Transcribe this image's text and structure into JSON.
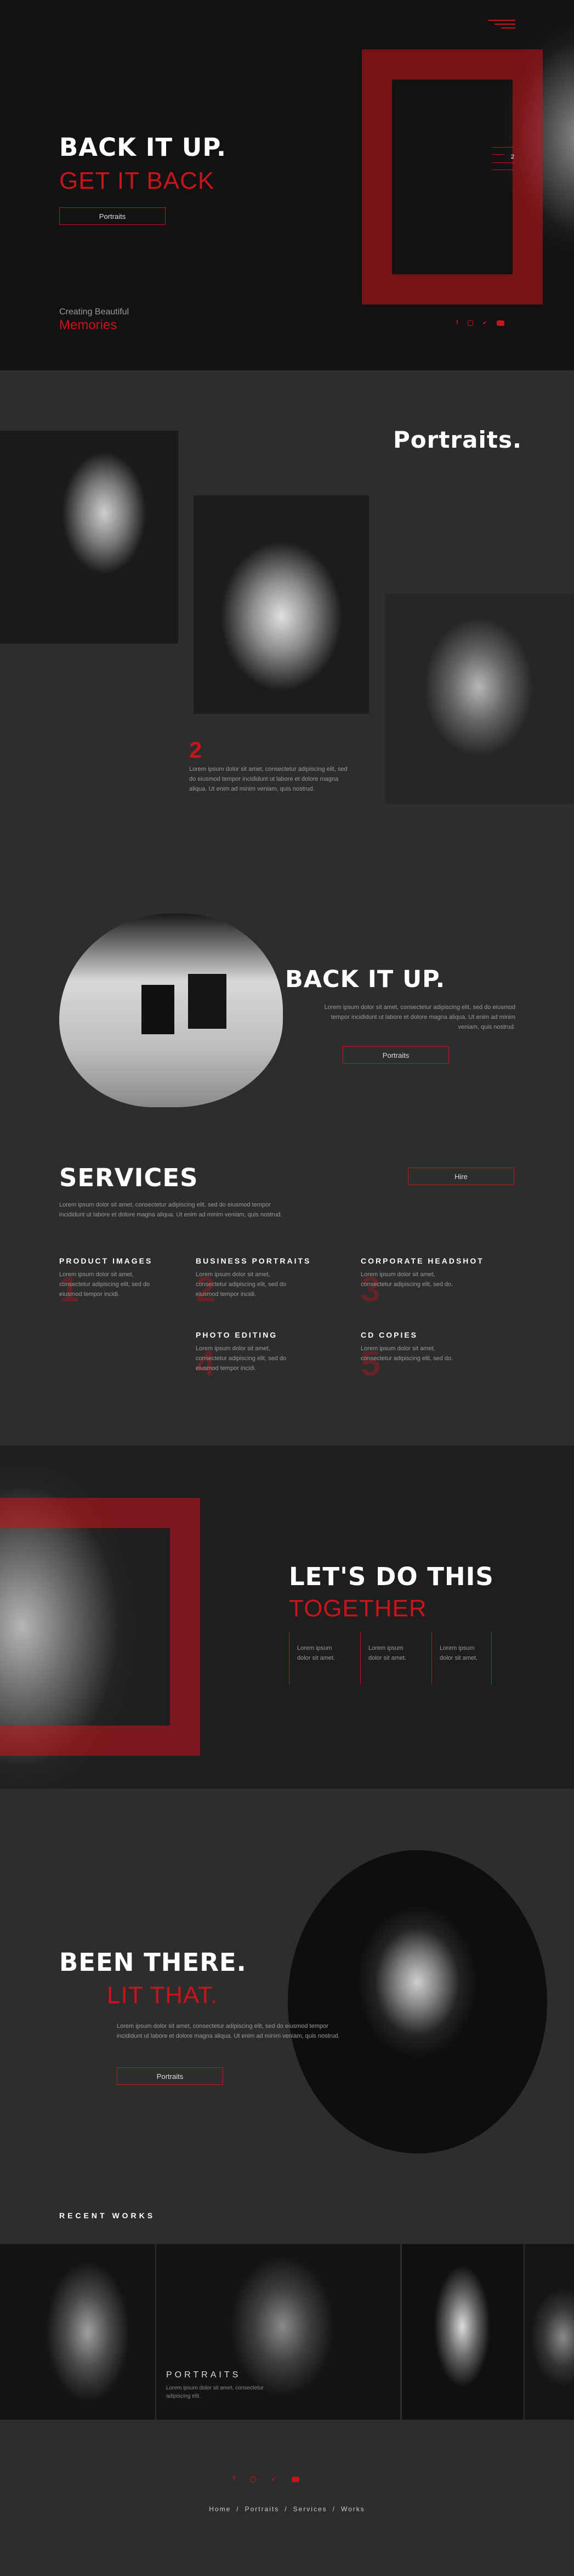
{
  "hero": {
    "title": "BACK IT UP.",
    "subtitle": "GET IT BACK",
    "button": "Portraits",
    "tagline": "Creating Beautiful",
    "tagline2": "Memories",
    "slide_number": "2"
  },
  "portraits": {
    "heading": "Portraits.",
    "number": "2",
    "text": "Lorem ipsum dolor sit amet, consectetur adipiscing elit, sed do eiusmod tempor incididunt ut labore et dolore magna aliqua. Ut enim ad minim veniam, quis nostrud."
  },
  "studio": {
    "title": "BACK IT UP.",
    "text": "Lorem ipsum dolor sit amet, consectetur adipiscing elit, sed do eiusmod tempor incididunt ut labore et dolore magna aliqua. Ut enim ad minim veniam, quis nostrud.",
    "button": "Portraits"
  },
  "services": {
    "title": "SERVICES",
    "button": "Hire",
    "intro": "Lorem ipsum dolor sit amet, consectetur adipiscing elit, sed do eiusmod tempor incididunt ut labore et dolore magna aliqua. Ut enim ad minim veniam, quis nostrud.",
    "items": [
      {
        "title": "PRODUCT IMAGES",
        "num": "1",
        "text": "Lorem ipsum dolor sit amet, consectetur adipiscing elit, sed do eiusmod tempor incidi."
      },
      {
        "title": "BUSINESS PORTRAITS",
        "num": "2",
        "text": "Lorem ipsum dolor sit amet, consectetur adipiscing elit, sed do eiusmod tempor incidi."
      },
      {
        "title": "CORPORATE HEADSHOT",
        "num": "3",
        "text": "Lorem ipsum dolor sit amet, consectetur adipiscing elit, sed do."
      },
      {
        "title": "PHOTO EDITING",
        "num": "4",
        "text": "Lorem ipsum dolor sit amet, consectetur adipiscing elit, sed do eiusmod tempor incidi."
      },
      {
        "title": "CD COPIES",
        "num": "5",
        "text": "Lorem ipsum dolor sit amet, consectetur adipiscing elit, sed do."
      }
    ]
  },
  "together": {
    "title": "LET'S DO THIS",
    "subtitle": "TOGETHER",
    "cols": [
      "Lorem ipsum dolor sit amet.",
      "Lorem ipsum dolor sit amet.",
      "Lorem ipsum dolor sit amet."
    ]
  },
  "been": {
    "title": "BEEN THERE.",
    "subtitle": "LIT THAT.",
    "text": "Lorem ipsum dolor sit amet, consectetur adipiscing elit, sed do eiusmod tempor incididunt ut labore et dolore magna aliqua. Ut enim ad minim veniam, quis nostrud.",
    "button": "Portraits"
  },
  "recent": {
    "heading": "RECENT WORKS",
    "caption": "PORTRAITS",
    "caption_text": "Lorem ipsum dolor sit amet, consectetur adipiscing elit."
  },
  "footer": {
    "nav": [
      "Home",
      "Portraits",
      "Services",
      "Works"
    ],
    "sep": "/"
  },
  "colors": {
    "accent": "#c8141b",
    "bg": "#2a2a2b",
    "dark": "#151516"
  }
}
